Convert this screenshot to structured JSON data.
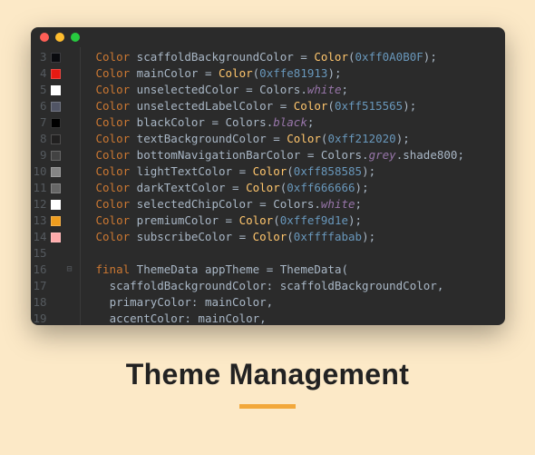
{
  "caption": "Theme Management",
  "lines": [
    {
      "num": 3,
      "swatch": "#0A0B0F",
      "code": [
        [
          "type",
          "Color"
        ],
        [
          "sp",
          " "
        ],
        [
          "ident",
          "scaffoldBackgroundColor"
        ],
        [
          "sp",
          " "
        ],
        [
          "op",
          "="
        ],
        [
          "sp",
          " "
        ],
        [
          "class",
          "Color"
        ],
        [
          "punc",
          "("
        ],
        [
          "num",
          "0xff0A0B0F"
        ],
        [
          "punc",
          ")"
        ],
        [
          "punc",
          ";"
        ]
      ]
    },
    {
      "num": 4,
      "swatch": "#e81913",
      "code": [
        [
          "type",
          "Color"
        ],
        [
          "sp",
          " "
        ],
        [
          "ident",
          "mainColor"
        ],
        [
          "sp",
          " "
        ],
        [
          "op",
          "="
        ],
        [
          "sp",
          " "
        ],
        [
          "class",
          "Color"
        ],
        [
          "punc",
          "("
        ],
        [
          "num",
          "0xffe81913"
        ],
        [
          "punc",
          ")"
        ],
        [
          "punc",
          ";"
        ]
      ]
    },
    {
      "num": 5,
      "swatch": "#ffffff",
      "code": [
        [
          "type",
          "Color"
        ],
        [
          "sp",
          " "
        ],
        [
          "ident",
          "unselectedColor"
        ],
        [
          "sp",
          " "
        ],
        [
          "op",
          "="
        ],
        [
          "sp",
          " "
        ],
        [
          "ident",
          "Colors"
        ],
        [
          "punc",
          "."
        ],
        [
          "prop",
          "white"
        ],
        [
          "punc",
          ";"
        ]
      ]
    },
    {
      "num": 6,
      "swatch": "#515565",
      "code": [
        [
          "type",
          "Color"
        ],
        [
          "sp",
          " "
        ],
        [
          "ident",
          "unselectedLabelColor"
        ],
        [
          "sp",
          " "
        ],
        [
          "op",
          "="
        ],
        [
          "sp",
          " "
        ],
        [
          "class",
          "Color"
        ],
        [
          "punc",
          "("
        ],
        [
          "num",
          "0xff515565"
        ],
        [
          "punc",
          ")"
        ],
        [
          "punc",
          ";"
        ]
      ]
    },
    {
      "num": 7,
      "swatch": "#000000",
      "code": [
        [
          "type",
          "Color"
        ],
        [
          "sp",
          " "
        ],
        [
          "ident",
          "blackColor"
        ],
        [
          "sp",
          " "
        ],
        [
          "op",
          "="
        ],
        [
          "sp",
          " "
        ],
        [
          "ident",
          "Colors"
        ],
        [
          "punc",
          "."
        ],
        [
          "prop",
          "black"
        ],
        [
          "punc",
          ";"
        ]
      ]
    },
    {
      "num": 8,
      "swatch": "#212020",
      "code": [
        [
          "type",
          "Color"
        ],
        [
          "sp",
          " "
        ],
        [
          "ident",
          "textBackgroundColor"
        ],
        [
          "sp",
          " "
        ],
        [
          "op",
          "="
        ],
        [
          "sp",
          " "
        ],
        [
          "class",
          "Color"
        ],
        [
          "punc",
          "("
        ],
        [
          "num",
          "0xff212020"
        ],
        [
          "punc",
          ")"
        ],
        [
          "punc",
          ";"
        ]
      ]
    },
    {
      "num": 9,
      "swatch": "#424242",
      "code": [
        [
          "type",
          "Color"
        ],
        [
          "sp",
          " "
        ],
        [
          "ident",
          "bottomNavigationBarColor"
        ],
        [
          "sp",
          " "
        ],
        [
          "op",
          "="
        ],
        [
          "sp",
          " "
        ],
        [
          "ident",
          "Colors"
        ],
        [
          "punc",
          "."
        ],
        [
          "prop",
          "grey"
        ],
        [
          "punc",
          "."
        ],
        [
          "ident",
          "shade800"
        ],
        [
          "punc",
          ";"
        ]
      ]
    },
    {
      "num": 10,
      "swatch": "#858585",
      "code": [
        [
          "type",
          "Color"
        ],
        [
          "sp",
          " "
        ],
        [
          "ident",
          "lightTextColor"
        ],
        [
          "sp",
          " "
        ],
        [
          "op",
          "="
        ],
        [
          "sp",
          " "
        ],
        [
          "class",
          "Color"
        ],
        [
          "punc",
          "("
        ],
        [
          "num",
          "0xff858585"
        ],
        [
          "punc",
          ")"
        ],
        [
          "punc",
          ";"
        ]
      ]
    },
    {
      "num": 11,
      "swatch": "#666666",
      "code": [
        [
          "type",
          "Color"
        ],
        [
          "sp",
          " "
        ],
        [
          "ident",
          "darkTextColor"
        ],
        [
          "sp",
          " "
        ],
        [
          "op",
          "="
        ],
        [
          "sp",
          " "
        ],
        [
          "class",
          "Color"
        ],
        [
          "punc",
          "("
        ],
        [
          "num",
          "0xff666666"
        ],
        [
          "punc",
          ")"
        ],
        [
          "punc",
          ";"
        ]
      ]
    },
    {
      "num": 12,
      "swatch": "#ffffff",
      "code": [
        [
          "type",
          "Color"
        ],
        [
          "sp",
          " "
        ],
        [
          "ident",
          "selectedChipColor"
        ],
        [
          "sp",
          " "
        ],
        [
          "op",
          "="
        ],
        [
          "sp",
          " "
        ],
        [
          "ident",
          "Colors"
        ],
        [
          "punc",
          "."
        ],
        [
          "prop",
          "white"
        ],
        [
          "punc",
          ";"
        ]
      ]
    },
    {
      "num": 13,
      "swatch": "#ef9d1e",
      "code": [
        [
          "type",
          "Color"
        ],
        [
          "sp",
          " "
        ],
        [
          "ident",
          "premiumColor"
        ],
        [
          "sp",
          " "
        ],
        [
          "op",
          "="
        ],
        [
          "sp",
          " "
        ],
        [
          "class",
          "Color"
        ],
        [
          "punc",
          "("
        ],
        [
          "num",
          "0xffef9d1e"
        ],
        [
          "punc",
          ")"
        ],
        [
          "punc",
          ";"
        ]
      ]
    },
    {
      "num": 14,
      "swatch": "#ffabab",
      "code": [
        [
          "type",
          "Color"
        ],
        [
          "sp",
          " "
        ],
        [
          "ident",
          "subscribeColor"
        ],
        [
          "sp",
          " "
        ],
        [
          "op",
          "="
        ],
        [
          "sp",
          " "
        ],
        [
          "class",
          "Color"
        ],
        [
          "punc",
          "("
        ],
        [
          "num",
          "0xffffabab"
        ],
        [
          "punc",
          ")"
        ],
        [
          "punc",
          ";"
        ]
      ]
    },
    {
      "num": 15,
      "swatch": null,
      "code": []
    },
    {
      "num": 16,
      "swatch": null,
      "fold": "⊟",
      "code": [
        [
          "key",
          "final"
        ],
        [
          "sp",
          " "
        ],
        [
          "ident",
          "ThemeData"
        ],
        [
          "sp",
          " "
        ],
        [
          "ident",
          "appTheme"
        ],
        [
          "sp",
          " "
        ],
        [
          "op",
          "="
        ],
        [
          "sp",
          " "
        ],
        [
          "ident",
          "ThemeData"
        ],
        [
          "punc",
          "("
        ]
      ]
    },
    {
      "num": 17,
      "swatch": null,
      "code": [
        [
          "sp",
          "  "
        ],
        [
          "param",
          "scaffoldBackgroundColor"
        ],
        [
          "punc",
          ":"
        ],
        [
          "sp",
          " "
        ],
        [
          "ident",
          "scaffoldBackgroundColor"
        ],
        [
          "punc",
          ","
        ]
      ]
    },
    {
      "num": 18,
      "swatch": null,
      "code": [
        [
          "sp",
          "  "
        ],
        [
          "param",
          "primaryColor"
        ],
        [
          "punc",
          ":"
        ],
        [
          "sp",
          " "
        ],
        [
          "ident",
          "mainColor"
        ],
        [
          "punc",
          ","
        ]
      ]
    },
    {
      "num": 19,
      "swatch": null,
      "code": [
        [
          "sp",
          "  "
        ],
        [
          "param",
          "accentColor"
        ],
        [
          "punc",
          ":"
        ],
        [
          "sp",
          " "
        ],
        [
          "ident",
          "mainColor"
        ],
        [
          "punc",
          ","
        ]
      ]
    }
  ]
}
